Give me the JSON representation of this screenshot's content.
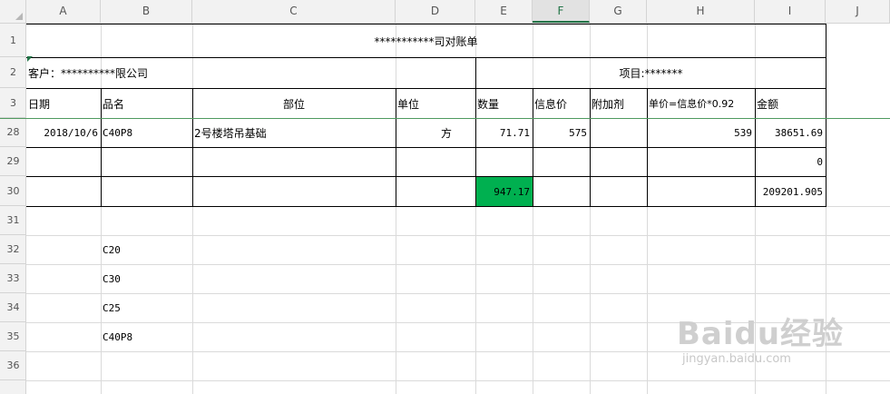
{
  "column_headers": [
    "A",
    "B",
    "C",
    "D",
    "E",
    "F",
    "G",
    "H",
    "I",
    "J"
  ],
  "active_column": "F",
  "row_numbers": [
    "1",
    "2",
    "3",
    "28",
    "29",
    "30",
    "31",
    "32",
    "33",
    "34",
    "35",
    "36"
  ],
  "sheet": {
    "title": "***********司对账单",
    "customer": "客户：**********限公司",
    "project": "项目:*******",
    "headers": {
      "date": "日期",
      "product": "品名",
      "location": "部位",
      "unit": "单位",
      "quantity": "数量",
      "info_price": "信息价",
      "additive": "附加剂",
      "unit_price": "单价=信息价*0.92",
      "amount": "金额"
    },
    "row28": {
      "date": "2018/10/6",
      "product": "C40P8",
      "location": "2号楼塔吊基础",
      "unit": "方",
      "quantity": "71.71",
      "info_price": "575",
      "unit_price": "539",
      "amount": "38651.69"
    },
    "row29": {
      "amount": "0"
    },
    "row30": {
      "quantity": "947.17",
      "amount": "209201.905"
    },
    "list": [
      "C20",
      "C30",
      "C25",
      "C40P8"
    ]
  },
  "watermark": {
    "logo": "Baidu经验",
    "sub": "jingyan.baidu.com"
  },
  "colors": {
    "accent": "#217346",
    "highlight": "#00b050",
    "grid": "#dadada"
  }
}
